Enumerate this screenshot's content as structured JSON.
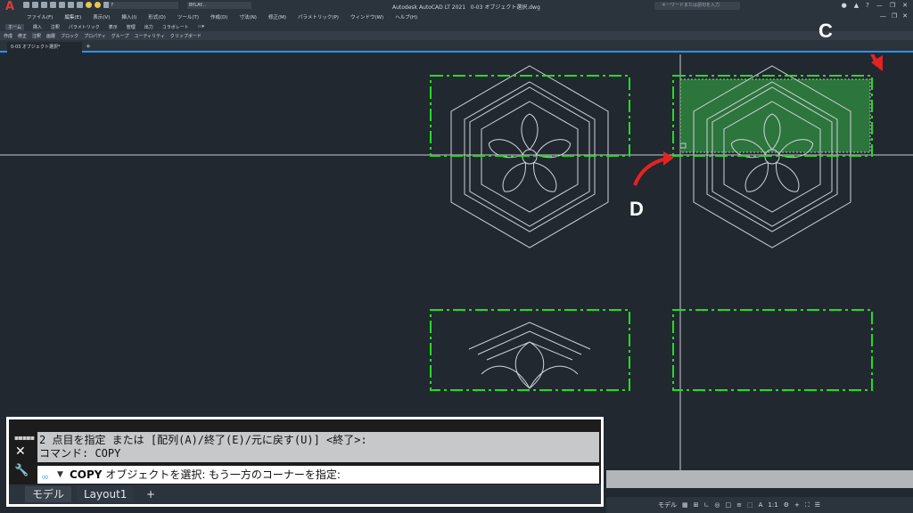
{
  "window": {
    "title": "Autodesk AutoCAD LT 2021",
    "file": "0-03 オブジェクト選択.dwg",
    "search_placeholder": "キーワードまたは語句を入力"
  },
  "toolbar": {
    "layer_value": "7",
    "linetype_value": "BYLAY..."
  },
  "menu": [
    "ファイル(F)",
    "編集(E)",
    "表示(V)",
    "挿入(I)",
    "形式(O)",
    "ツール(T)",
    "作成(D)",
    "寸法(N)",
    "修正(M)",
    "パラメトリック(P)",
    "ウィンドウ(W)",
    "ヘルプ(H)"
  ],
  "ribbon_tabs": [
    "ホーム",
    "挿入",
    "注釈",
    "パラメトリック",
    "表示",
    "管理",
    "出力",
    "コラボレート"
  ],
  "ribbon_panels": [
    "作成",
    "修正",
    "注釈",
    "画層",
    "ブロック",
    "プロパティ",
    "グループ",
    "ユーティリティ",
    "クリップボード"
  ],
  "doc_tab": "0-03 オブジェクト選択*",
  "annotations": {
    "c": "C",
    "d": "D"
  },
  "command": {
    "history_line1": "2 点目を指定 または [配列(A)/終了(E)/元に戻す(U)] <終了>:",
    "history_line2": "コマンド:  COPY",
    "input_cmd": "COPY",
    "input_prompt": "オブジェクトを選択: もう一方のコーナーを指定:"
  },
  "layout_tabs": {
    "model": "モデル",
    "layout1": "Layout1",
    "add": "+"
  },
  "status": {
    "model": "モデル",
    "scale": "1:1"
  },
  "colors": {
    "background": "#212830",
    "selection_box": "#22dd22",
    "selection_fill": "#2e7d3e",
    "arrow": "#e52222"
  }
}
